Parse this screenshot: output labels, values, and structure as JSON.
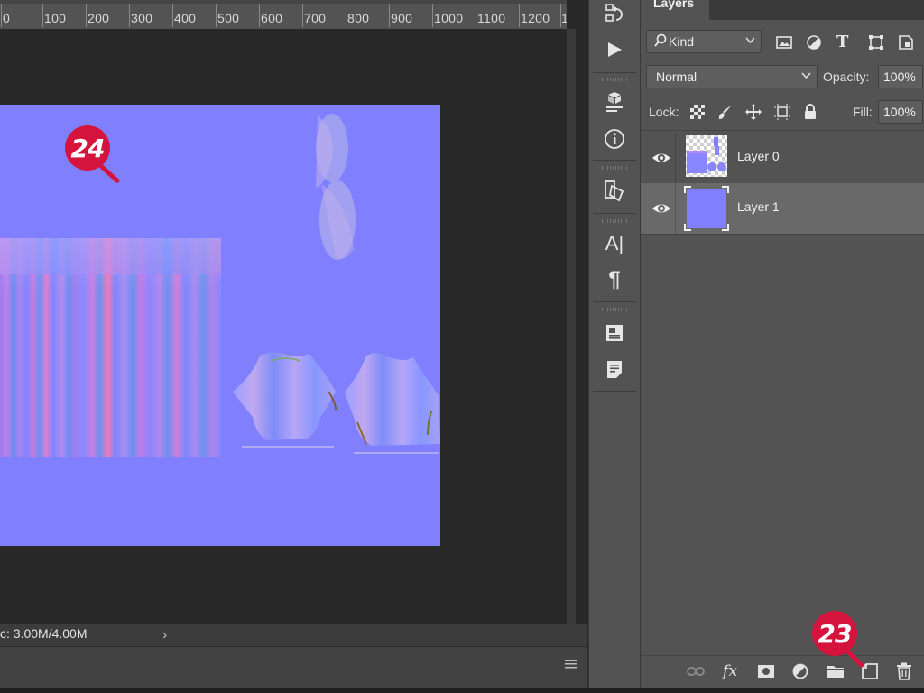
{
  "ruler": {
    "labels": [
      "0",
      "100",
      "200",
      "300",
      "400",
      "500",
      "600",
      "700",
      "800",
      "900",
      "1000",
      "1100",
      "1200",
      "1"
    ]
  },
  "status": {
    "text": "c: 3.00M/4.00M",
    "arrow": "›"
  },
  "timeline": {
    "menu_icon": "hamburger-menu-icon"
  },
  "toolstrip": {
    "icons": [
      "history-icon",
      "play-action-icon",
      "3d-icon",
      "info-icon",
      "properties-icon",
      "character-icon",
      "paragraph-icon",
      "glyphs-icon",
      "notes-icon"
    ],
    "character_glyph": "A|",
    "paragraph_glyph": "¶",
    "info_glyph": "ⓘ"
  },
  "layers_panel": {
    "tab_label": "Layers",
    "filter": {
      "search_icon": "search-icon",
      "kind_label": "Kind"
    },
    "blend_mode": "Normal",
    "opacity_label": "Opacity:",
    "opacity_value": "100%",
    "lock_label": "Lock:",
    "fill_label": "Fill:",
    "fill_value": "100%",
    "layers": [
      {
        "name": "Layer 0",
        "visible": true,
        "selected": false
      },
      {
        "name": "Layer 1",
        "visible": true,
        "selected": true
      }
    ],
    "bottom_icons": [
      "link-icon",
      "fx-icon",
      "mask-icon",
      "adjustment-icon",
      "folder-icon",
      "new-layer-icon",
      "trash-icon"
    ],
    "fx_label": "fx"
  },
  "annotations": {
    "badge_23": "23",
    "badge_24": "24"
  },
  "colors": {
    "normal_map_blue": "#8080ff",
    "badge_red": "#d4143c"
  }
}
